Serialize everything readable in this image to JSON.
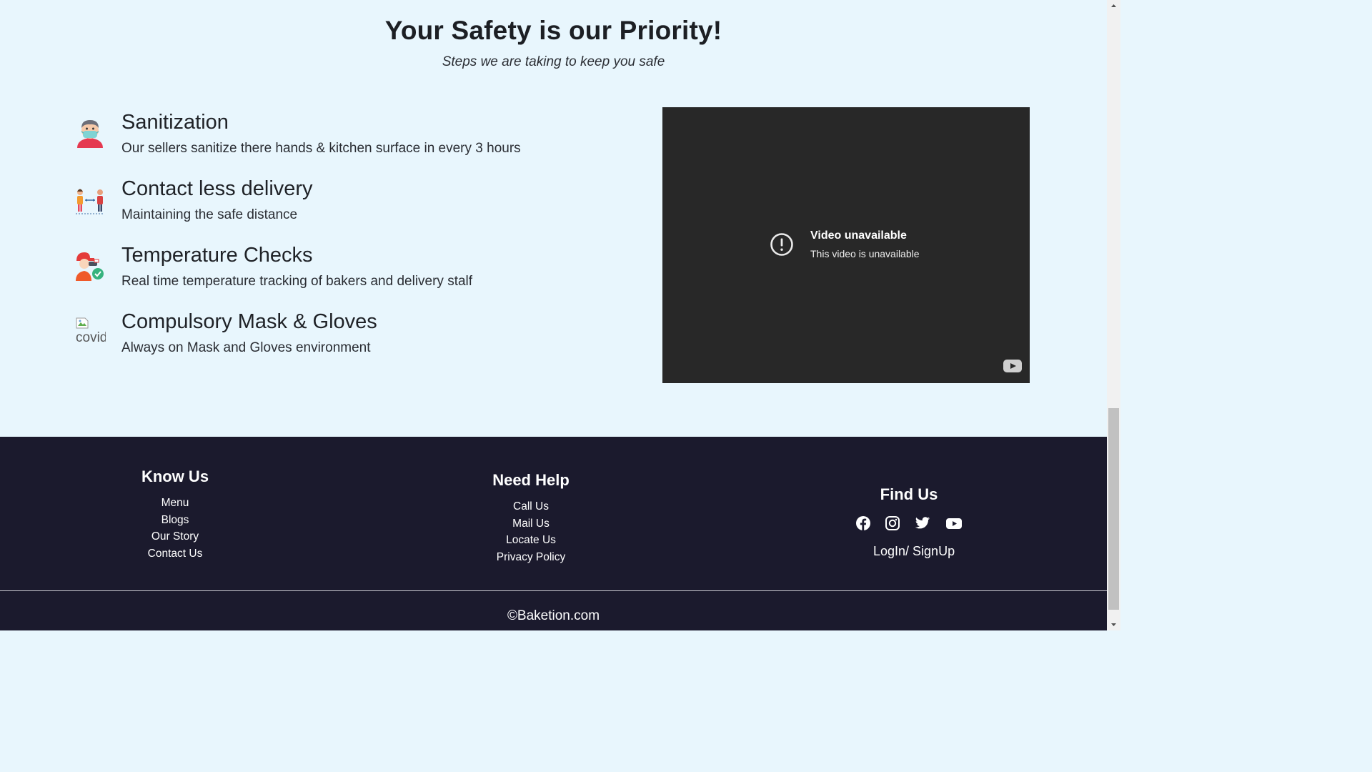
{
  "safety": {
    "title": "Your Safety is our Priority!",
    "subtitle": "Steps we are taking to keep you safe",
    "features": [
      {
        "icon": "masked-person-icon",
        "title": "Sanitization",
        "desc": "Our sellers sanitize there hands & kitchen surface in every 3 hours"
      },
      {
        "icon": "social-distance-icon",
        "title": "Contact less delivery",
        "desc": "Maintaining the safe distance"
      },
      {
        "icon": "temperature-check-icon",
        "title": "Temperature Checks",
        "desc": "Real time temperature tracking of bakers and delivery stalf"
      },
      {
        "icon": "broken-image-icon",
        "title": "Compulsory Mask & Gloves",
        "desc": "Always on Mask and Gloves environment",
        "img_alt": "covid"
      }
    ]
  },
  "video": {
    "title": "Video unavailable",
    "subtitle": "This video is unavailable",
    "icons": [
      "alert-circle-icon",
      "youtube-icon"
    ]
  },
  "footer": {
    "know_us": {
      "heading": "Know Us",
      "links": [
        "Menu",
        "Blogs",
        "Our Story",
        "Contact Us"
      ]
    },
    "need_help": {
      "heading": "Need Help",
      "links": [
        "Call Us",
        "Mail Us",
        "Locate Us",
        "Privacy Policy"
      ]
    },
    "find_us": {
      "heading": "Find Us",
      "socials": [
        "facebook-icon",
        "instagram-icon",
        "twitter-icon",
        "youtube-icon"
      ],
      "login": "LogIn/ SignUp"
    },
    "copyright": "©Baketion.com"
  },
  "colors": {
    "section_bg": "#e8f6fd",
    "footer_bg": "#1b1a2d",
    "video_bg": "#282828",
    "text_dark": "#1f2227"
  }
}
